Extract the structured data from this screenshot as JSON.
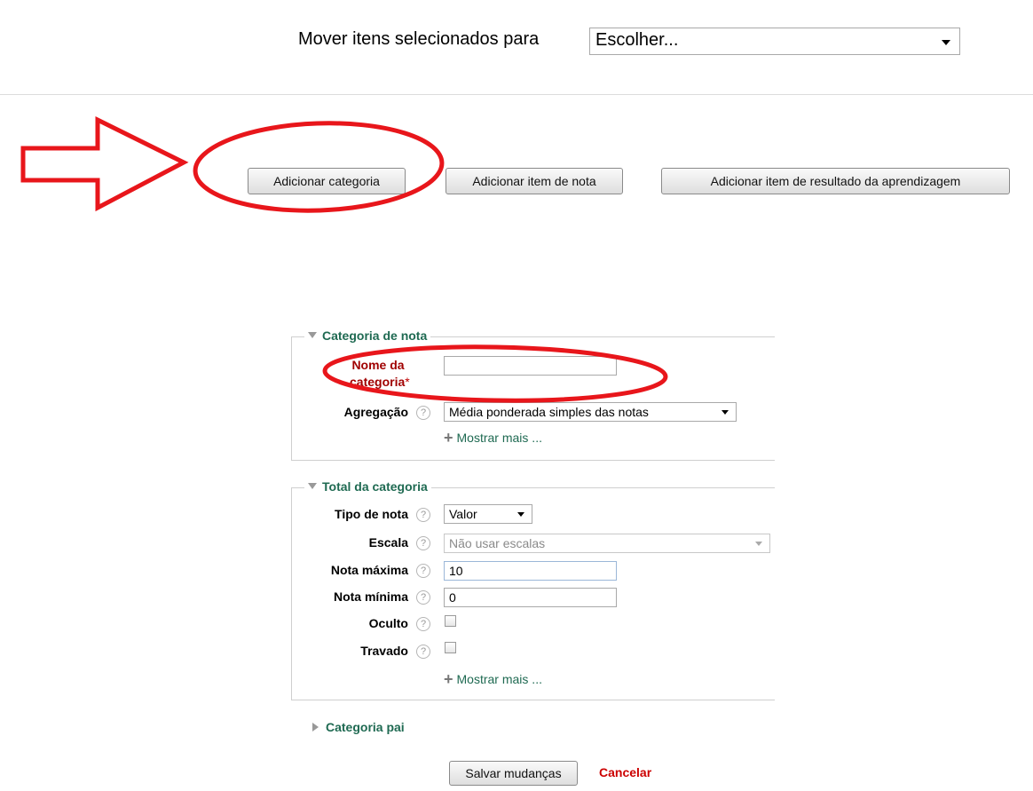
{
  "move_bar": {
    "label": "Mover itens selecionados para",
    "selected": "Escolher..."
  },
  "buttons": {
    "add_category": "Adicionar categoria",
    "add_grade_item": "Adicionar item de nota",
    "add_outcome_item": "Adicionar item de resultado da aprendizagem"
  },
  "grade_category": {
    "legend": "Categoria de nota",
    "name_label_line1": "Nome da",
    "name_label_line2": "categoria",
    "required_mark": "*",
    "name_value": "",
    "aggregation_label": "Agregação",
    "aggregation_value": "Média ponderada simples das notas",
    "show_more": "Mostrar mais ..."
  },
  "category_total": {
    "legend": "Total da categoria",
    "grade_type_label": "Tipo de nota",
    "grade_type_value": "Valor",
    "scale_label": "Escala",
    "scale_value": "Não usar escalas",
    "max_grade_label": "Nota máxima",
    "max_grade_value": "10",
    "min_grade_label": "Nota mínima",
    "min_grade_value": "0",
    "hidden_label": "Oculto",
    "hidden_checked": false,
    "locked_label": "Travado",
    "locked_checked": false,
    "show_more": "Mostrar mais ..."
  },
  "parent_category": {
    "legend": "Categoria pai"
  },
  "actions": {
    "save": "Salvar mudanças",
    "cancel": "Cancelar"
  },
  "help_icon_glyph": "?",
  "annotation_color": "#e8161b"
}
